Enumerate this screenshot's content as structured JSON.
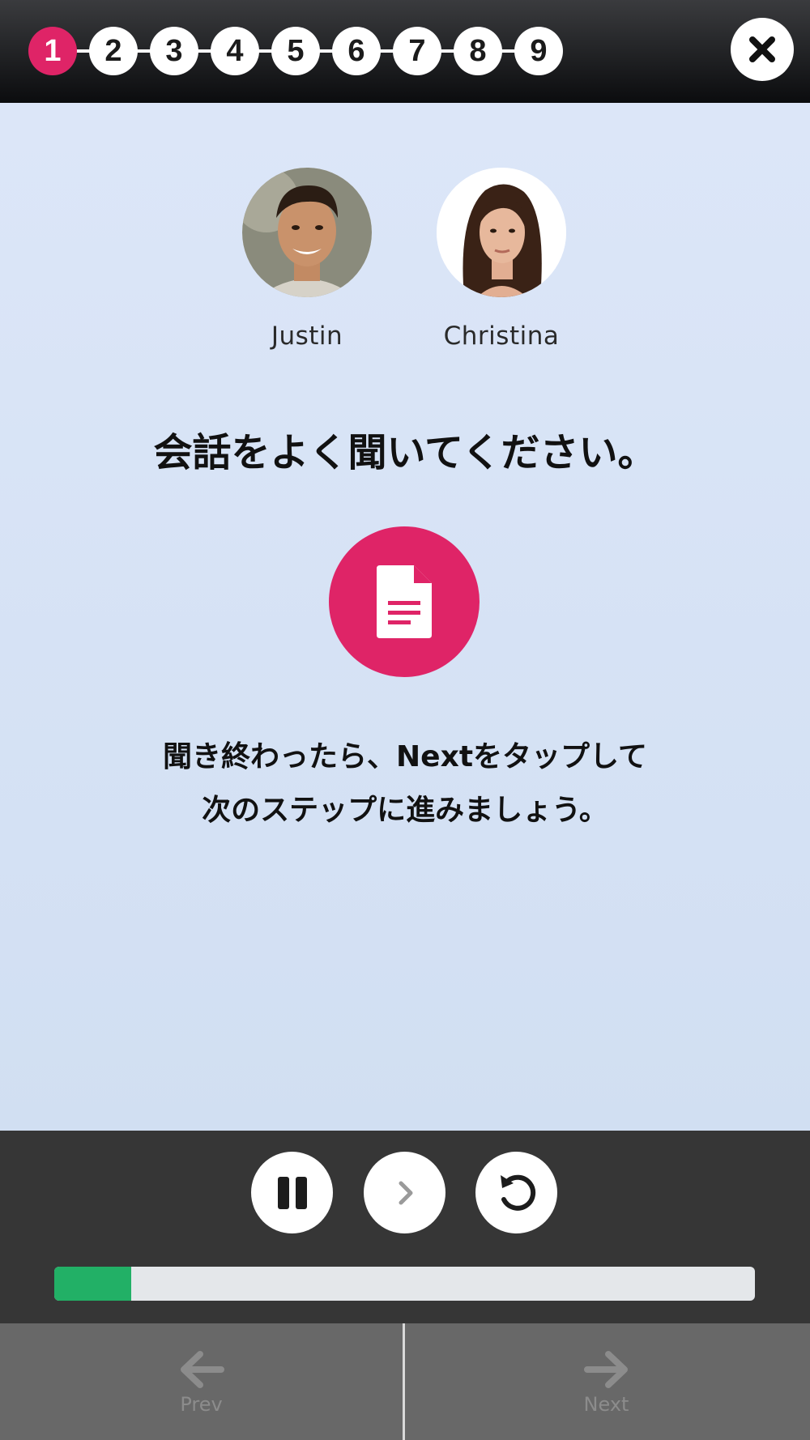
{
  "stepper": {
    "steps": [
      "1",
      "2",
      "3",
      "4",
      "5",
      "6",
      "7",
      "8",
      "9"
    ],
    "active_step": "1"
  },
  "close": {
    "icon": "close-icon"
  },
  "speakers": [
    {
      "name": "Justin",
      "avatar": "male-avatar"
    },
    {
      "name": "Christina",
      "avatar": "female-avatar"
    }
  ],
  "instruction": "会話をよく聞いてください。",
  "transcript_button": {
    "icon": "document-icon"
  },
  "hint": {
    "line1": "聞き終わったら、Nextをタップして",
    "line2": "次のステップに進みましょう。"
  },
  "player": {
    "pause_icon": "pause-icon",
    "play_icon": "chevron-right-icon",
    "replay_icon": "replay-icon",
    "progress_fraction": 0.11
  },
  "nav": {
    "prev_label": "Prev",
    "next_label": "Next"
  },
  "colors": {
    "accent": "#df2467",
    "progress": "#22b066",
    "background": "#dce6f8",
    "topbar": "#0b0c0e",
    "player": "#363636",
    "nav": "#686868"
  }
}
